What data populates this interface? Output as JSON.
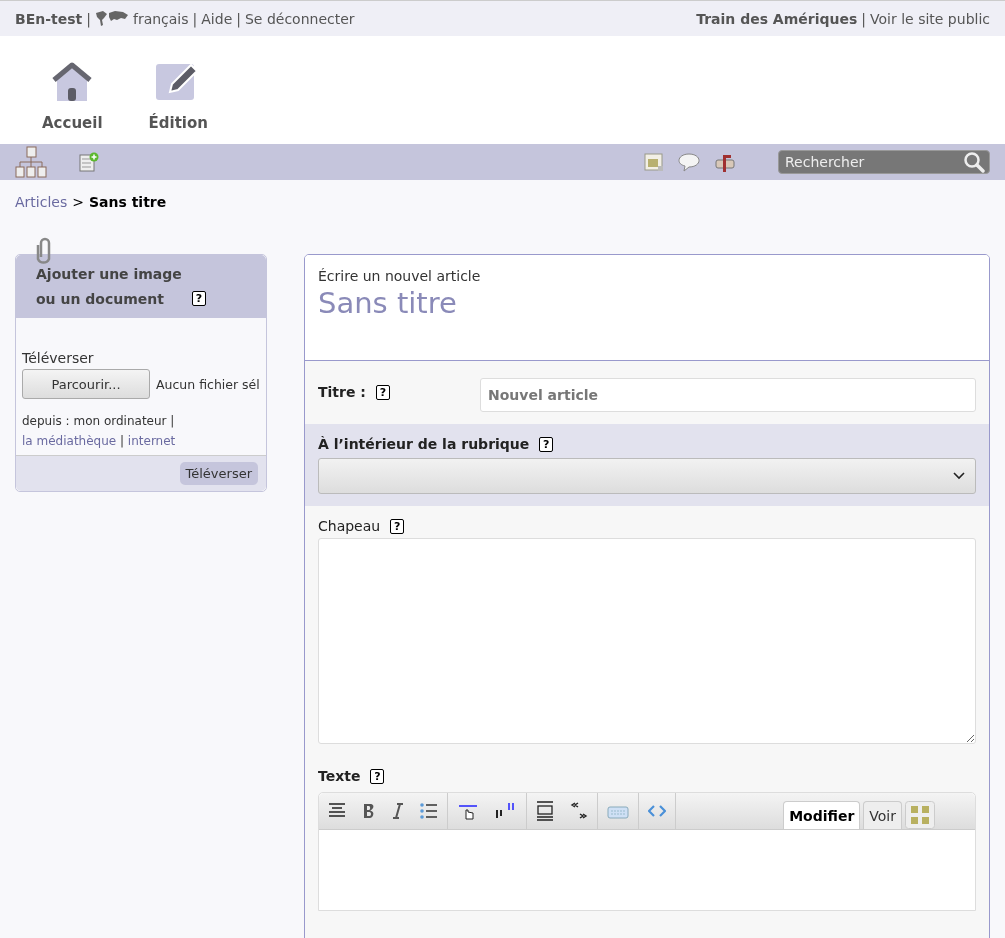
{
  "top_bar": {
    "site": "BEn-test",
    "sep_1": "|",
    "language": "français",
    "sep_2": "|",
    "help": "Aide",
    "sep_3": "|",
    "logout": "Se déconnecter",
    "site_name": "Train des Amériques",
    "sep_4": "|",
    "public_site": "Voir le site public"
  },
  "main_nav": [
    {
      "label": "Accueil",
      "kind": "home"
    },
    {
      "label": "Édition",
      "kind": "edit"
    }
  ],
  "search": {
    "placeholder": "Rechercher"
  },
  "breadcrumb": {
    "parent": "Articles",
    "separator": ">",
    "current": "Sans titre"
  },
  "upload_box": {
    "title_line_1": "Ajouter une image",
    "title_line_2": "ou un document",
    "help": "?",
    "upload_label": "Téléverser",
    "browse_button": "Parcourir...",
    "no_file": "Aucun fichier sél",
    "source_prefix": "depuis : mon ordinateur |",
    "source_link_1": "la médiathèque",
    "source_sep": "|",
    "source_link_2": "internet",
    "submit": "Téléverser"
  },
  "form": {
    "subtitle": "Écrire un nouvel article",
    "title": "Sans titre",
    "fields": [
      {
        "kind": "text",
        "label": "Titre :",
        "help": "?",
        "placeholder": "Nouvel article"
      },
      {
        "kind": "select",
        "label": "À l’intérieur de la rubrique",
        "help": "?"
      },
      {
        "kind": "textarea",
        "label": "Chapeau",
        "help": "?"
      },
      {
        "kind": "editor",
        "label": "Texte",
        "help": "?",
        "tabs": [
          {
            "label": "Modifier",
            "selected": true
          },
          {
            "label": "Voir",
            "selected": false
          }
        ]
      }
    ]
  }
}
